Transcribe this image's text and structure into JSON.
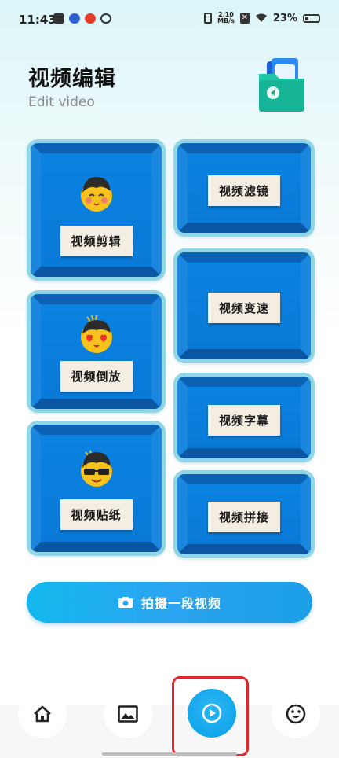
{
  "status_bar": {
    "time": "11:43",
    "net_speed_value": "2.10",
    "net_speed_unit": "MB/s",
    "battery": "23%"
  },
  "header": {
    "title": "视频编辑",
    "subtitle": "Edit video",
    "icon": "folder-icon"
  },
  "tools": [
    {
      "label": "视频剪辑",
      "icon": "emoji-blush-icon"
    },
    {
      "label": "视频倒放",
      "icon": "emoji-heart-eyes-icon"
    },
    {
      "label": "视频贴纸",
      "icon": "emoji-sunglasses-icon"
    },
    {
      "label": "视频滤镜"
    },
    {
      "label": "视频变速"
    },
    {
      "label": "视频字幕"
    },
    {
      "label": "视频拼接"
    }
  ],
  "capture": {
    "label": "拍摄一段视频",
    "icon": "camera-icon"
  },
  "nav": {
    "items": [
      "home-icon",
      "gallery-icon",
      "video-play-icon",
      "emoji-face-icon"
    ],
    "active": "video-play-icon"
  },
  "colors": {
    "accent": "#0aa0e6",
    "tile_border": "#8fd6e6",
    "tile_face": "#0a7ad8",
    "label_bg": "#f4eee2",
    "highlight": "#e0262a"
  }
}
